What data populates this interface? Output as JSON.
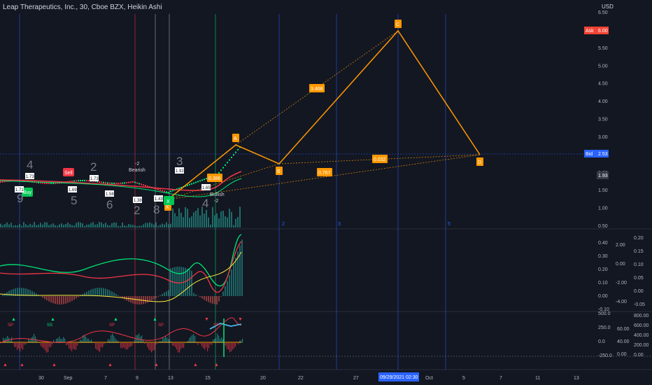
{
  "header": {
    "title": "Leap Therapeutics, Inc., 30, Cboe BZX, Heikin Ashi",
    "currency": "USD"
  },
  "price_scale": {
    "ticks": [
      "6.50",
      "6.00",
      "5.50",
      "5.00",
      "4.50",
      "4.00",
      "3.50",
      "3.00",
      "2.50",
      "2.00",
      "1.50",
      "1.00",
      "0.50"
    ],
    "ask_label": "Ask",
    "ask_value": "6.00",
    "bid_label": "Bid",
    "bid_value": "2.53",
    "last_value": "1.93"
  },
  "time_axis": {
    "labels": [
      "30",
      "Sep",
      "7",
      "9",
      "13",
      "15",
      "20",
      "22",
      "27",
      "Oct",
      "5",
      "7",
      "11",
      "13"
    ],
    "cursor_label": "09/29/2021 02:30"
  },
  "colors": {
    "background": "#131722",
    "pattern": "#ff9800",
    "up": "#26a69a",
    "down": "#ef5350",
    "grid_blue": "#2962ff",
    "green": "#00e676",
    "red": "#f23645",
    "ask": "#f44336",
    "bid": "#2962ff"
  },
  "chart_data": [
    {
      "type": "line",
      "name": "price-panel",
      "ylim": [
        0.5,
        6.5
      ],
      "harmonic_pattern": {
        "points": [
          {
            "label": "X",
            "x": "Sep 13",
            "y": 1.45
          },
          {
            "label": "A",
            "x": "Sep 16",
            "y": 2.75
          },
          {
            "label": "B",
            "x": "Sep 21",
            "y": 2.22
          },
          {
            "label": "C",
            "x": "Sep 29",
            "y": 6.0
          },
          {
            "label": "D",
            "x": "Oct 6",
            "y": 2.5
          }
        ],
        "ratios": [
          "3.468",
          "0.386",
          "0.767",
          "0.032"
        ]
      },
      "trade_signals": [
        {
          "text": "Sell",
          "type": "sell"
        },
        {
          "text": "Buy",
          "type": "buy"
        },
        {
          "text": "X",
          "type": "buy"
        }
      ],
      "price_labels": [
        "1.73",
        "1.73",
        "1.71",
        "1.69",
        "1.58",
        "1.38",
        "1.43",
        "1.92",
        "1.65",
        "0.386"
      ],
      "sequence_numbers": [
        "4",
        "9",
        "5",
        "2",
        "6",
        "2",
        "8",
        "3",
        "4"
      ],
      "annotations": {
        "bearish": "-2\nBearish",
        "bullish": "Bullish\n-2"
      },
      "cycle_labels": [
        "2",
        "3",
        "5"
      ]
    },
    {
      "type": "line",
      "name": "oscillator-panel",
      "ticks_a": [
        "0.40",
        "0.30",
        "0.20",
        "0.10",
        "0.00",
        "-0.10"
      ],
      "ticks_b": [
        "2.00",
        "0.00",
        "-2.00",
        "-4.00"
      ],
      "ticks_c": [
        "0.20",
        "0.15",
        "0.10",
        "0.05",
        "0.00",
        "-0.05"
      ]
    },
    {
      "type": "line",
      "name": "momentum-panel",
      "ticks_a": [
        "500.0",
        "250.0",
        "0.0",
        "-250.0"
      ],
      "ticks_b": [
        "60.00",
        "40.00",
        "0.00"
      ],
      "ticks_c": [
        "800.00",
        "600.00",
        "400.00",
        "200.00",
        "0.00"
      ],
      "signal_marks": [
        "SP",
        "SS",
        "SP",
        "SP",
        "SP"
      ]
    }
  ]
}
